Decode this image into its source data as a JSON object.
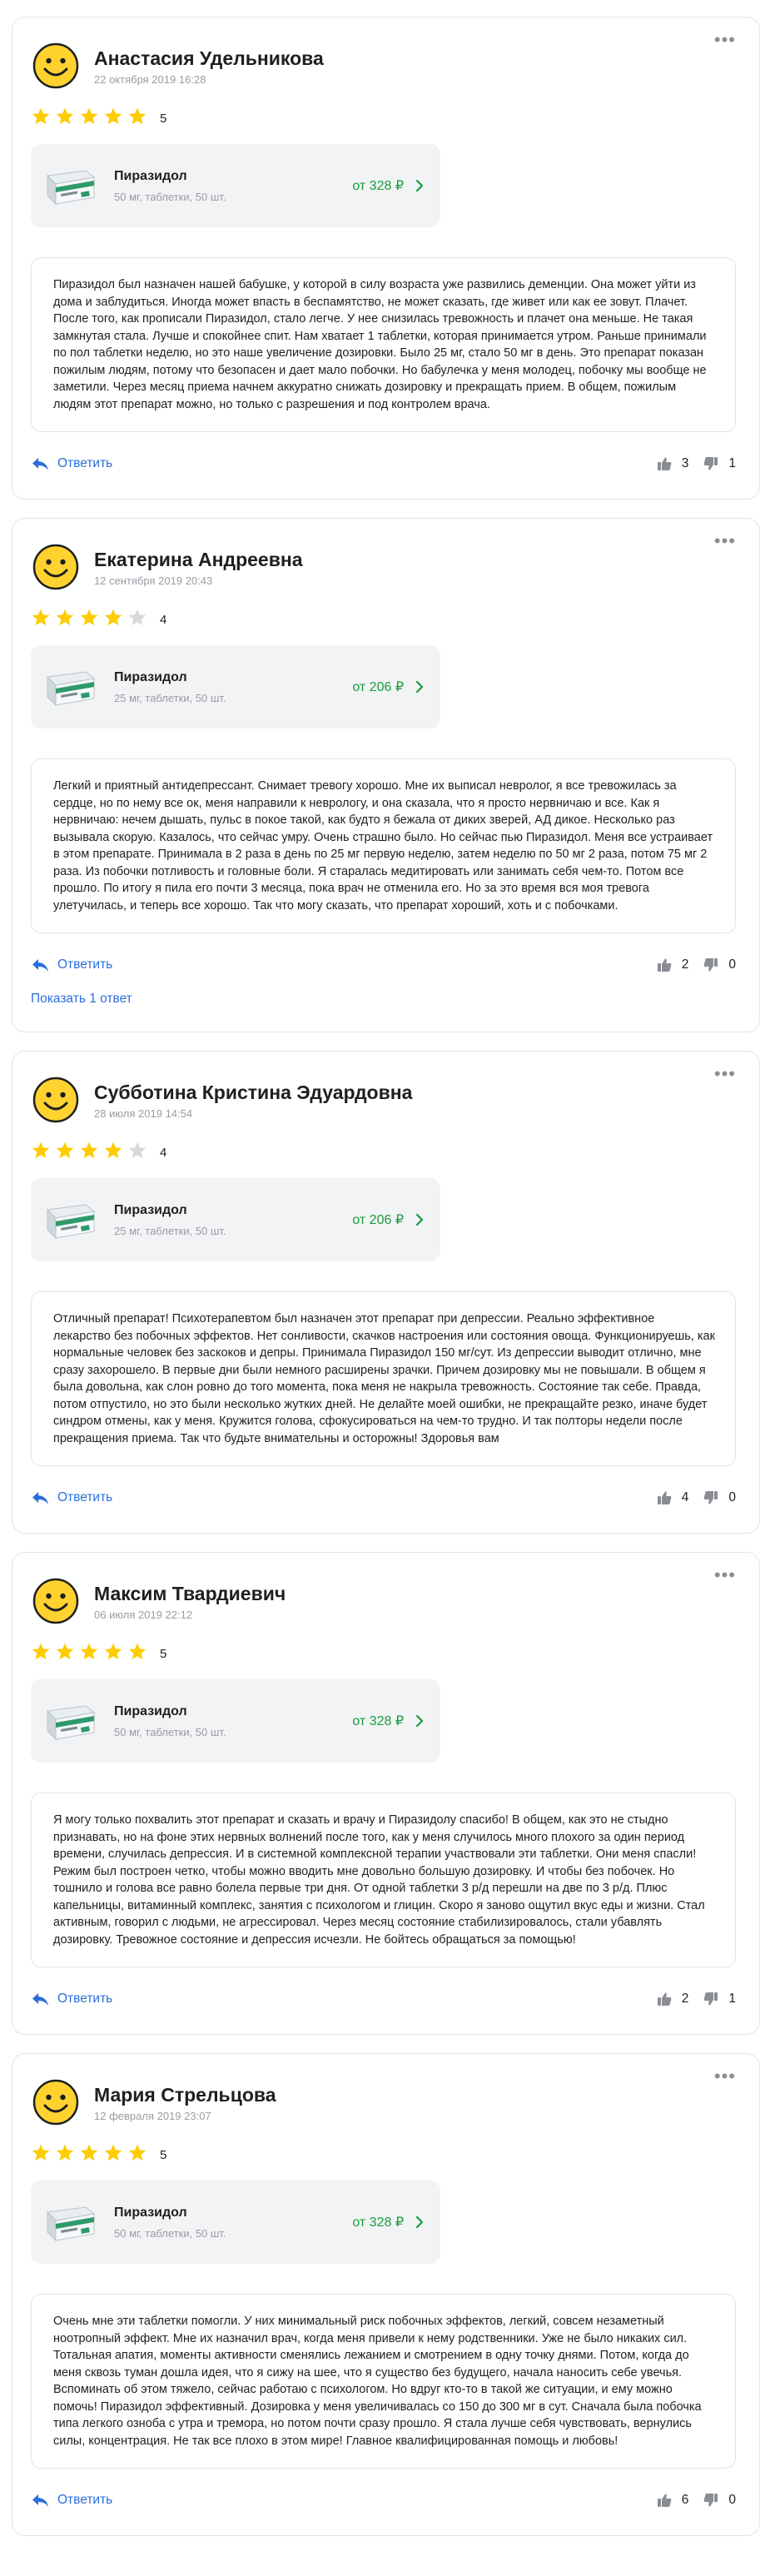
{
  "colors": {
    "accent": "#2a6fdb",
    "price": "#1a9c3e",
    "star": "#ffcc00",
    "star_empty": "#d9d9dd"
  },
  "reviews": [
    {
      "author": "Анастасия Удельникова",
      "date": "22 октября 2019 16:28",
      "rating": 5,
      "rating_label": "5",
      "product": {
        "name": "Пиразидол",
        "desc": "50 мг, таблетки, 50 шт.",
        "price": "от 328 ₽"
      },
      "text": "Пиразидол был назначен нашей бабушке, у которой в силу возраста уже развились деменции. Она может уйти из дома и заблудиться. Иногда может впасть в беспамятство, не может сказать, где живет или как ее зовут. Плачет. После того, как прописали Пиразидол, стало легче. У нее снизилась тревожность и плачет она меньше. Не такая замкнутая стала. Лучше и спокойнее спит. Нам хватает 1 таблетки, которая принимается утром. Раньше принимали по пол таблетки неделю, но это наше увеличение дозировки. Было 25 мг, стало 50 мг в день. Это препарат показан пожилым людям, потому что безопасен и дает мало побочки. Но бабулечка у меня молодец, побочку мы вообще не заметили. Через месяц приема начнем аккуратно снижать дозировку и прекращать прием. В общем, пожилым людям этот препарат можно, но только с разрешения и под контролем врача.",
      "reply_label": "Ответить",
      "likes": "3",
      "dislikes": "1"
    },
    {
      "author": "Екатерина Андреевна",
      "date": "12 сентября 2019 20:43",
      "rating": 4,
      "rating_label": "4",
      "product": {
        "name": "Пиразидол",
        "desc": "25 мг, таблетки, 50 шт.",
        "price": "от 206 ₽"
      },
      "text": "Легкий и приятный антидепрессант. Снимает тревогу хорошо. Мне их выписал невролог, я все тревожилась за сердце, но по нему все ок, меня направили к неврологу, и она сказала, что я просто нервничаю и все. Как я нервничаю: нечем дышать, пульс в покое такой, как будто я бежала от диких зверей, АД дикое. Несколько раз вызывала скорую. Казалось, что сейчас умру. Очень страшно было. Но сейчас пью Пиразидол. Меня все устраивает в этом препарате. Принимала в 2 раза в день по 25 мг первую неделю, затем неделю по 50 мг 2 раза, потом 75 мг 2 раза. Из побочки потливость и головные боли. Я старалась медитировать или занимать себя чем-то. Потом все прошло. По итогу я пила его почти 3 месяца, пока врач не отменила его. Но за это время вся моя тревога улетучилась, и теперь все хорошо. Так что могу сказать, что препарат хороший, хоть и с побочками.",
      "reply_label": "Ответить",
      "likes": "2",
      "dislikes": "0",
      "show_answers": "Показать 1 ответ"
    },
    {
      "author": "Субботина Кристина Эдуардовна",
      "date": "28 июля 2019 14:54",
      "rating": 4,
      "rating_label": "4",
      "product": {
        "name": "Пиразидол",
        "desc": "25 мг, таблетки, 50 шт.",
        "price": "от 206 ₽"
      },
      "text": "Отличный препарат! Психотерапевтом был назначен этот препарат при депрессии. Реально эффективное лекарство без побочных эффектов. Нет сонливости, скачков настроения или состояния овоща. Функционируешь, как нормальные человек без заскоков и депры. Принимала Пиразидол 150 мг/сут. Из депрессии выводит отлично, мне сразу захорошело. В первые дни были немного расширены зрачки. Причем дозировку мы не повышали. В общем я была довольна, как слон ровно до того момента, пока меня не накрыла тревожность. Состояние так себе. Правда, потом отпустило, но это были несколько жутких дней. Не делайте моей ошибки, не прекращайте резко, иначе будет синдром отмены, как у меня. Кружится голова, сфокусироваться на чем-то трудно. И так полторы недели после прекращения приема. Так что будьте внимательны и осторожны! Здоровья вам",
      "reply_label": "Ответить",
      "likes": "4",
      "dislikes": "0"
    },
    {
      "author": "Максим Твардиевич",
      "date": "06 июля 2019 22:12",
      "rating": 5,
      "rating_label": "5",
      "product": {
        "name": "Пиразидол",
        "desc": "50 мг, таблетки, 50 шт.",
        "price": "от 328 ₽"
      },
      "text": "Я могу только похвалить этот препарат и сказать и врачу и Пиразидолу спасибо! В общем, как это не стыдно признавать, но на фоне этих нервных волнений после того, как у меня случилось много плохого за один период времени, случилась депрессия. И в системной комплексной терапии участвовали эти таблетки. Они меня спасли! Режим был построен четко, чтобы можно вводить мне довольно большую дозировку. И чтобы без побочек. Но тошнило и голова все равно болела первые три дня. От одной таблетки 3 р/д перешли на две по 3 р/д. Плюс капельницы, витаминный комплекс, занятия с психологом и глицин. Скоро я заново ощутил вкус еды и жизни. Стал активным, говорил с людьми, не агрессировал. Через месяц состояние стабилизировалось, стали убавлять дозировку. Тревожное состояние и депрессия исчезли. Не бойтесь обращаться за помощью!",
      "reply_label": "Ответить",
      "likes": "2",
      "dislikes": "1"
    },
    {
      "author": "Мария Стрельцова",
      "date": "12 февраля 2019 23:07",
      "rating": 5,
      "rating_label": "5",
      "product": {
        "name": "Пиразидол",
        "desc": "50 мг, таблетки, 50 шт.",
        "price": "от 328 ₽"
      },
      "text": "Очень мне эти таблетки помогли. У них минимальный риск побочных эффектов, легкий, совсем незаметный ноотропный эффект. Мне их назначил врач, когда меня привели к нему родственники. Уже не было никаких сил. Тотальная апатия, моменты активности сменялись лежанием и смотрением в одну точку днями. Потом, когда до меня сквозь туман дошла идея, что я сижу на шее, что я существо без будущего, начала наносить себе увечья. Вспоминать об этом тяжело, сейчас работаю с психологом. Но вдруг кто-то в такой же ситуации, и ему можно помочь! Пиразидол эффективный. Дозировка у меня увеличивалась со 150 до 300 мг в сут. Сначала была побочка типа легкого озноба с утра и тремора, но потом почти сразу прошло. Я стала лучше себя чувствовать, вернулись силы, концентрация. Не так все плохо в этом мире! Главное квалифицированная помощь и любовь!",
      "reply_label": "Ответить",
      "likes": "6",
      "dislikes": "0"
    }
  ]
}
